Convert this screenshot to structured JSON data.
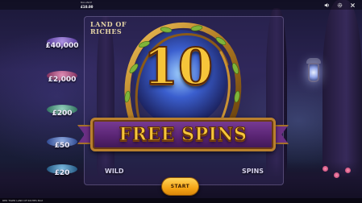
{
  "header": {
    "balance_label": "BALANCE",
    "balance_value": "£10.00",
    "icons": [
      "speaker-icon",
      "settings-icon",
      "close-icon"
    ]
  },
  "game": {
    "title_line1": "LAND OF",
    "title_line2": "RICHES",
    "paytable": [
      "£40,000",
      "£2,000",
      "£200",
      "£50",
      "£20"
    ],
    "reel_labels": {
      "wild": "WILD",
      "spins": "SPINS"
    }
  },
  "feature": {
    "count": "10",
    "label": "FREE SPINS"
  },
  "actions": {
    "start_label": "START"
  },
  "footer": {
    "text": "RED TIGER LAND OF RICHES MAX"
  },
  "colors": {
    "accent_gold": "#f6c53a",
    "banner_purple": "#5a2574",
    "button_orange": "#f5a516"
  }
}
